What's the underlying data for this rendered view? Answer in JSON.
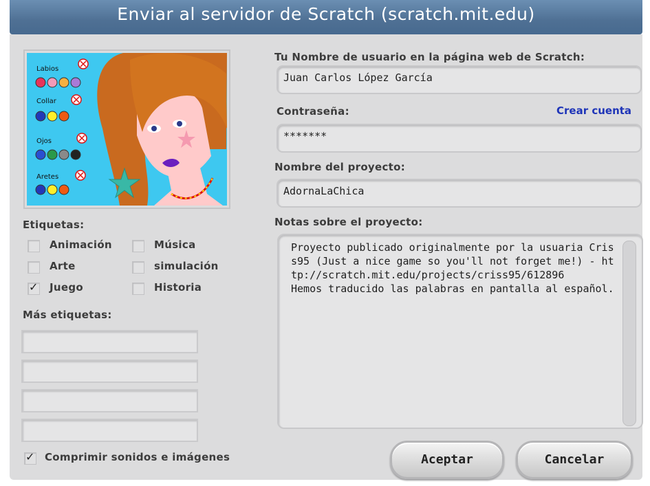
{
  "window": {
    "title": "Enviar al servidor de Scratch (scratch.mit.edu)"
  },
  "thumbnail": {
    "labels": [
      "Labios",
      "Collar",
      "Ojos",
      "Aretes"
    ],
    "colors": {
      "sky": "#3ec8f0",
      "hair": "#c96a1f",
      "skin": "#ffcaca",
      "lips": "#6a1fbf"
    }
  },
  "username": {
    "label": "Tu Nombre de usuario en la página web de Scratch:",
    "value": "Juan Carlos López García"
  },
  "password": {
    "label": "Contraseña:",
    "value": "*******",
    "create_account": "Crear cuenta"
  },
  "project_name": {
    "label": "Nombre del proyecto:",
    "value": "AdornaLaChica"
  },
  "notes": {
    "label": "Notas sobre el proyecto:",
    "value": "Proyecto publicado originalmente por la usuaria Criss95 (Just a nice game so you'll not forget me!) - http://scratch.mit.edu/projects/criss95/612896\nHemos traducido las palabras en pantalla al español."
  },
  "tags": {
    "label": "Etiquetas:",
    "items": [
      {
        "label": "Animación",
        "checked": false
      },
      {
        "label": "Música",
        "checked": false
      },
      {
        "label": "Arte",
        "checked": false
      },
      {
        "label": "simulación",
        "checked": false
      },
      {
        "label": "Juego",
        "checked": true
      },
      {
        "label": "Historia",
        "checked": false
      }
    ],
    "more_label": "Más etiquetas:",
    "more_values": [
      "",
      "",
      "",
      ""
    ]
  },
  "compress": {
    "label": "Comprimir sonidos e imágenes",
    "checked": true
  },
  "buttons": {
    "ok": "Aceptar",
    "cancel": "Cancelar"
  }
}
